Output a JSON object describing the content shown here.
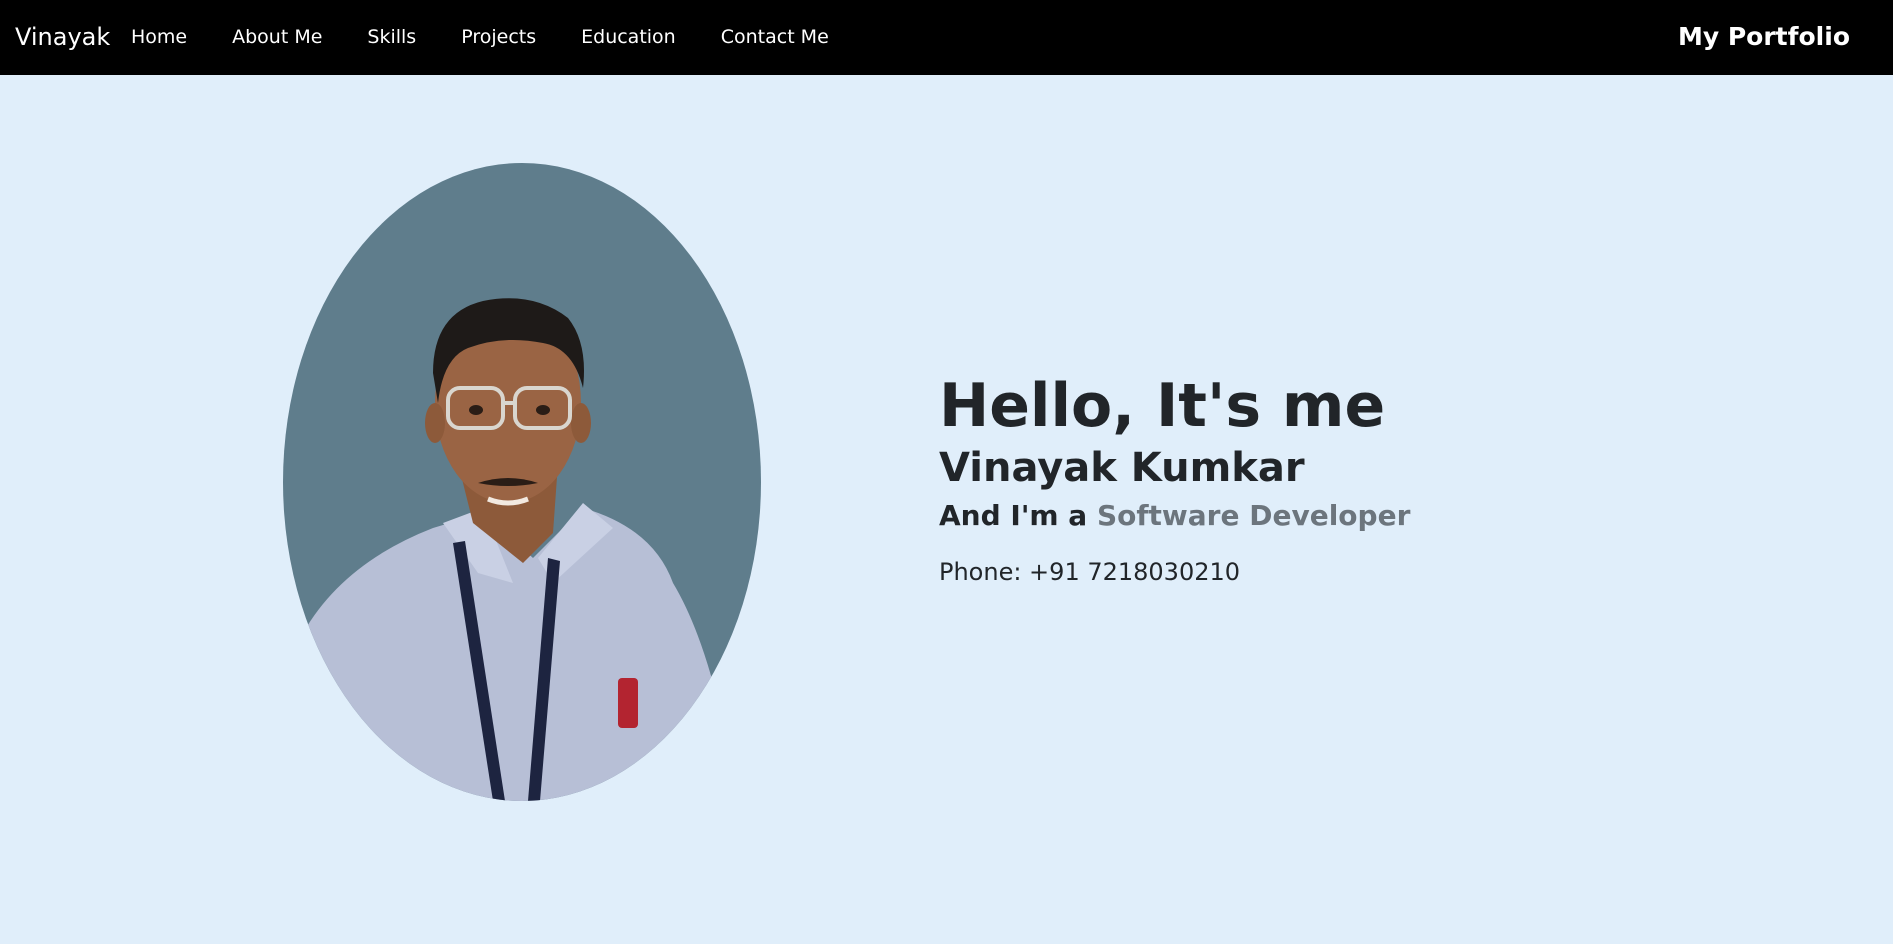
{
  "nav": {
    "brand": "Vinayak",
    "links": [
      "Home",
      "About Me",
      "Skills",
      "Projects",
      "Education",
      "Contact Me"
    ],
    "right_label": "My Portfolio"
  },
  "hero": {
    "greeting": "Hello, It's me",
    "name": "Vinayak Kumkar",
    "role_prefix": "And I'm a ",
    "role": "Software Developer",
    "phone": "Phone: +91 7218030210"
  },
  "colors": {
    "navbar_bg": "#000000",
    "page_bg": "#e0eefa",
    "photo_bg": "#5f7d8c",
    "role_accent": "#6c757d"
  }
}
